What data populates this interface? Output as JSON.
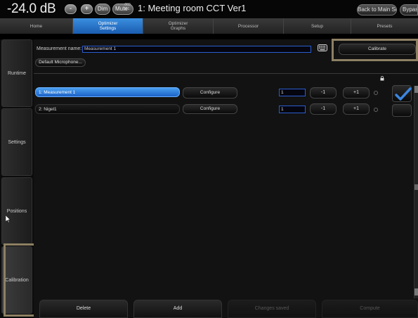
{
  "topbar": {
    "volume": "-24.0 dB",
    "minus": "-",
    "plus": "+",
    "dim": "Dim",
    "mute": "Mute",
    "meter": ".003 101.",
    "title": "1: Meeting room CCT Ver1",
    "back": "Back to Main Screen",
    "bypass": "Bypas"
  },
  "tabs": [
    {
      "line1": "Home",
      "line2": ""
    },
    {
      "line1": "Optimizer",
      "line2": "Settings"
    },
    {
      "line1": "Optimizer",
      "line2": "Graphs"
    },
    {
      "line1": "Processor",
      "line2": ""
    },
    {
      "line1": "Setup",
      "line2": ""
    },
    {
      "line1": "Presets",
      "line2": ""
    }
  ],
  "sidebar": {
    "runtime": "Runtime",
    "settings": "Settings",
    "positions": "Positions",
    "calibration": "Calibration"
  },
  "main": {
    "measurement_label": "Measurement name:",
    "measurement_value": "Measurement 1",
    "default_mic": "Default Microphone...",
    "calibrate": "Calibrate"
  },
  "rows": [
    {
      "name": "1: Measurement 1",
      "configure": "Configure",
      "num": "1",
      "minus": "-1",
      "plus": "+1",
      "selected": true,
      "checked": true
    },
    {
      "name": "2: Nigel1",
      "configure": "Configure",
      "num": "1",
      "minus": "-1",
      "plus": "+1",
      "selected": false,
      "checked": false
    }
  ],
  "bottom": {
    "delete": "Delete",
    "add": "Add",
    "changes": "Changes saved",
    "compute": "Compute"
  },
  "colors": {
    "accent": "#2f7fd8",
    "highlight": "#8d8063"
  }
}
